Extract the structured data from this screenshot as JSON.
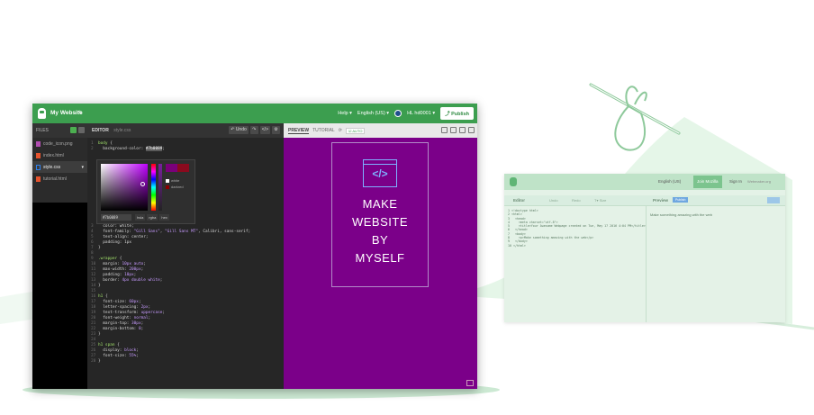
{
  "topbar": {
    "site_name": "My Website",
    "help": "Help ▾",
    "language": "English (US) ▾",
    "user": "HL hd0001 ▾",
    "publish": "Publish"
  },
  "files": {
    "header": "FILES",
    "items": [
      {
        "name": "code_icon.png",
        "type": "image"
      },
      {
        "name": "index.html",
        "type": "html"
      },
      {
        "name": "style.css",
        "type": "css",
        "active": true
      },
      {
        "name": "tutorial.html",
        "type": "html"
      }
    ]
  },
  "editor": {
    "title": "EDITOR",
    "filename": "style.css",
    "undo": "Undo",
    "lines_top": [
      {
        "n": "1",
        "html": "<span class='c-sel'>body</span> {"
      },
      {
        "n": "2",
        "html": "  background-color: <span class='c-hl'>#7b0089</span>;"
      }
    ],
    "lines_bottom": [
      {
        "n": "3",
        "html": "  color: white;"
      },
      {
        "n": "4",
        "html": "  font-family: <span class='c-val'>\"Gill Sans\"</span>, <span class='c-val'>\"Gill Sans MT\"</span>, Calibri, sans-serif;"
      },
      {
        "n": "5",
        "html": "  text-align: center;"
      },
      {
        "n": "6",
        "html": "  padding: 1px"
      },
      {
        "n": "7",
        "html": "}"
      },
      {
        "n": "8",
        "html": ""
      },
      {
        "n": "9",
        "html": "<span class='c-sel'>.wrapper</span> {"
      },
      {
        "n": "10",
        "html": "  margin: <span class='c-val'>10px auto</span>;"
      },
      {
        "n": "11",
        "html": "  max-width: <span class='c-val'>200px</span>;"
      },
      {
        "n": "12",
        "html": "  padding: <span class='c-val'>10px</span>;"
      },
      {
        "n": "13",
        "html": "  border: <span class='c-val'>4px double white</span>;"
      },
      {
        "n": "14",
        "html": "}"
      },
      {
        "n": "15",
        "html": ""
      },
      {
        "n": "16",
        "html": "<span class='c-sel'>h1</span> {"
      },
      {
        "n": "17",
        "html": "  font-size: <span class='c-val'>60px</span>;"
      },
      {
        "n": "18",
        "html": "  letter-spacing: <span class='c-val'>2px</span>;"
      },
      {
        "n": "19",
        "html": "  text-transform: <span class='c-val'>uppercase</span>;"
      },
      {
        "n": "20",
        "html": "  font-weight: <span class='c-val'>normal</span>;"
      },
      {
        "n": "21",
        "html": "  margin-top: <span class='c-val'>30px</span>;"
      },
      {
        "n": "22",
        "html": "  margin-bottom: <span class='c-val'>0</span>;"
      },
      {
        "n": "23",
        "html": "}"
      },
      {
        "n": "24",
        "html": ""
      },
      {
        "n": "25",
        "html": "<span class='c-sel'>h1 span</span> {"
      },
      {
        "n": "26",
        "html": "  display: <span class='c-val'>block</span>;"
      },
      {
        "n": "27",
        "html": "  font-size: <span class='c-val'>55%</span>;"
      },
      {
        "n": "28",
        "html": "}"
      }
    ]
  },
  "color_picker": {
    "hex": "#7b0089",
    "opt_white": "white",
    "opt_darkred": "darkred",
    "btn_hsla": "hsla",
    "btn_rgba": "rgba",
    "btn_hex": "hex"
  },
  "preview": {
    "title": "PREVIEW",
    "tutorial": "TUTORIAL",
    "auto": "AUTO",
    "code_glyph": "</>",
    "poster_lines": [
      "MAKE",
      "WEBSITE",
      "BY",
      "MYSELF"
    ],
    "bg_color": "#7b0089"
  },
  "secondary": {
    "language": "English (US)",
    "join": "Join Mozilla",
    "signin": "Sign In",
    "brand": "Webmaker.org",
    "editor_label": "Editor",
    "tools": [
      "Undo",
      "Redo",
      "T▾ Size"
    ],
    "preview_label": "Preview",
    "preview_btn": "Publish",
    "code_lines": [
      "1 <!doctype html>",
      "2 <html>",
      "3   <head>",
      "4     <meta charset=\"utf-8\">",
      "5     <title>Your Awesome Webpage created on Tue, May 17 2016 4:04 PM</title>",
      "6   </head>",
      "7   <body>",
      "8     <p>Make something amazing with the web</p>",
      "9   </body>",
      "10 </html>"
    ],
    "preview_text": "Make something amazing with the web"
  }
}
